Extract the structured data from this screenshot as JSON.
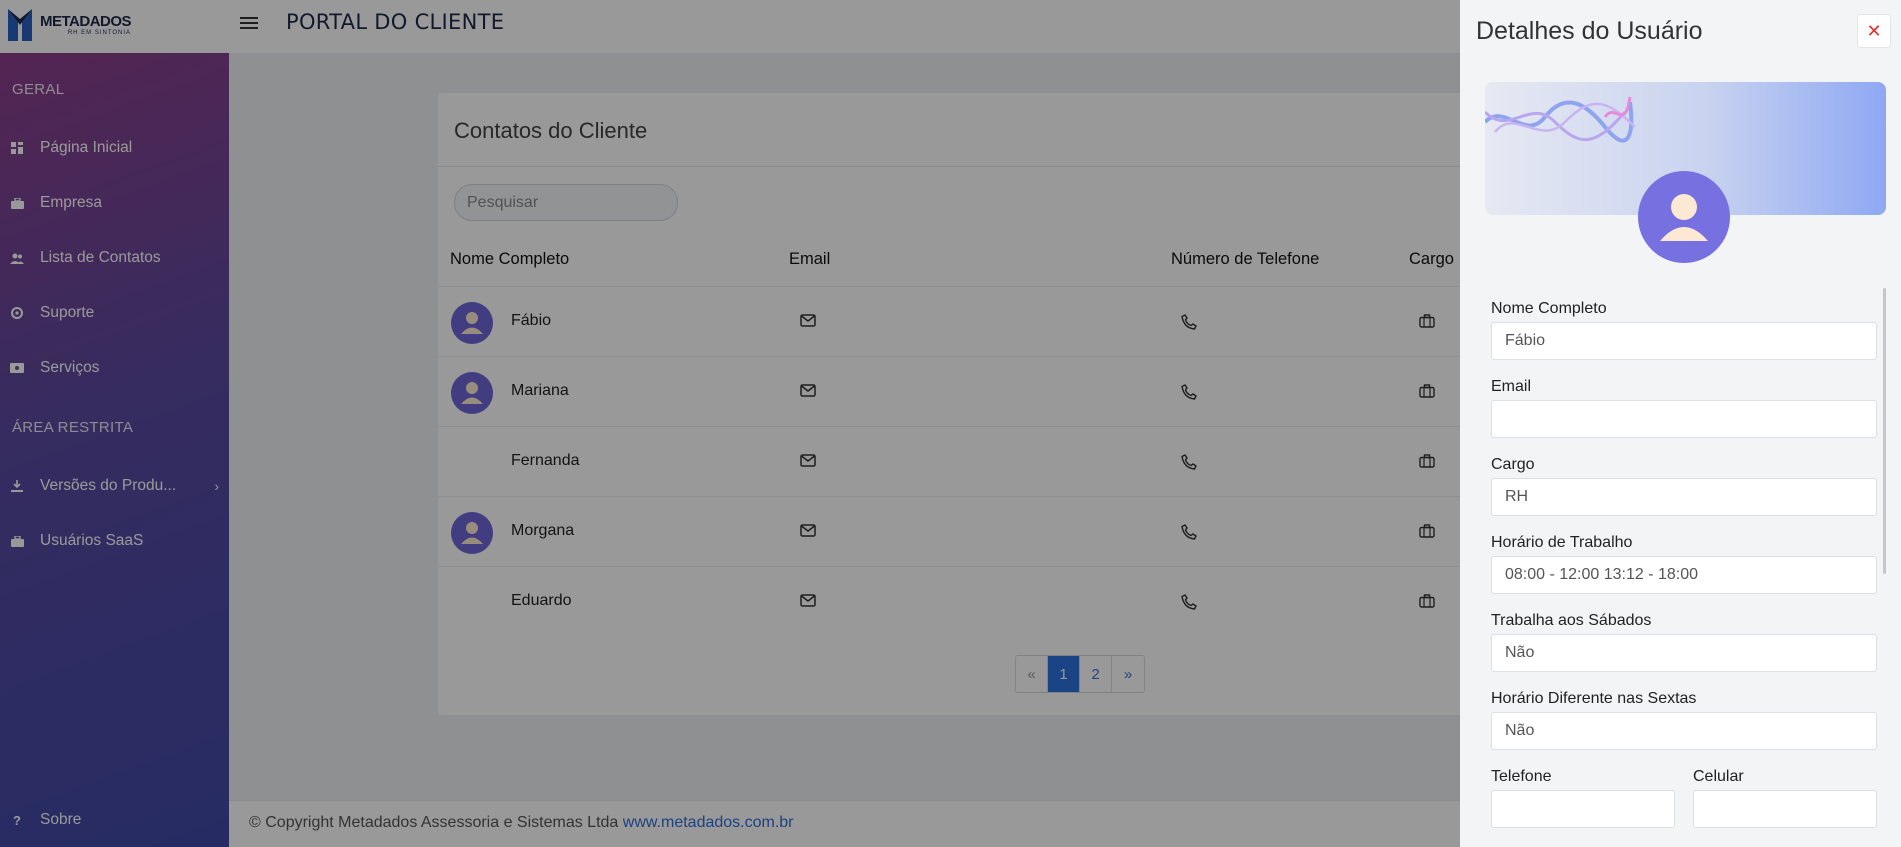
{
  "header": {
    "logo_name": "METADADOS",
    "logo_sub": "RH EM SINTONIA",
    "title": "PORTAL DO CLIENTE"
  },
  "sidebar": {
    "section_general": "GERAL",
    "section_restricted": "ÁREA RESTRITA",
    "items": [
      {
        "label": "Página Inicial",
        "icon": "dashboard-icon"
      },
      {
        "label": "Empresa",
        "icon": "briefcase-icon"
      },
      {
        "label": "Lista de Contatos",
        "icon": "users-icon"
      },
      {
        "label": "Suporte",
        "icon": "support-icon"
      },
      {
        "label": "Serviços",
        "icon": "money-icon"
      },
      {
        "label": "Versões do Produ...",
        "icon": "download-icon"
      },
      {
        "label": "Usuários SaaS",
        "icon": "briefcase-icon"
      }
    ],
    "about": "Sobre"
  },
  "contacts": {
    "title": "Contatos do Cliente",
    "search_placeholder": "Pesquisar",
    "columns": [
      "Nome Completo",
      "Email",
      "Número de Telefone",
      "Cargo"
    ],
    "rows": [
      {
        "name": "Fábio",
        "has_avatar": true
      },
      {
        "name": "Mariana",
        "has_avatar": true
      },
      {
        "name": "Fernanda",
        "has_avatar": false
      },
      {
        "name": "Morgana",
        "has_avatar": true
      },
      {
        "name": "Eduardo",
        "has_avatar": false
      }
    ],
    "pagination": {
      "prev": "«",
      "pages": [
        "1",
        "2"
      ],
      "next": "»",
      "current": "1"
    }
  },
  "footer": {
    "text": "© Copyright Metadados Assessoria e Sistemas Ltda",
    "link": "www.metadados.com.br"
  },
  "panel": {
    "title": "Detalhes do Usuário",
    "close": "✕",
    "fields": {
      "nome_label": "Nome Completo",
      "nome_value": "Fábio",
      "email_label": "Email",
      "email_value": "",
      "cargo_label": "Cargo",
      "cargo_value": "RH",
      "horario_label": "Horário de Trabalho",
      "horario_value": "08:00 - 12:00 13:12 - 18:00",
      "sabados_label": "Trabalha aos Sábados",
      "sabados_value": "Não",
      "sextas_label": "Horário Diferente nas Sextas",
      "sextas_value": "Não",
      "telefone_label": "Telefone",
      "celular_label": "Celular"
    }
  },
  "colors": {
    "sidebar_top": "#8c3e8a",
    "sidebar_bottom": "#3f4aa6",
    "accent": "#2e72e0",
    "avatar": "#6d66d6",
    "close": "#e03030"
  }
}
